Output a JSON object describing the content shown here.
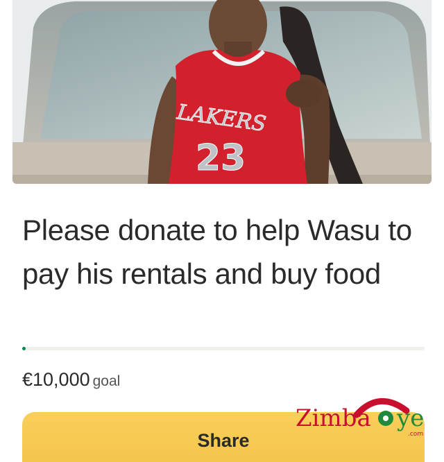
{
  "hero": {
    "jersey_team": "LAKERS",
    "jersey_number": "23"
  },
  "campaign": {
    "title": "Please donate to help Wasu to pay his rentals and buy food",
    "goal_amount": "€10,000",
    "goal_label": "goal",
    "progress_fraction": 0.005
  },
  "actions": {
    "share_label": "Share"
  },
  "watermark": {
    "brand_left": "Zimba",
    "brand_right": "ye",
    "domain": ".com"
  },
  "colors": {
    "progress": "#028858",
    "share_button": "#f6c84f",
    "watermark_red": "#c8102e",
    "watermark_green": "#1f8a3a"
  }
}
